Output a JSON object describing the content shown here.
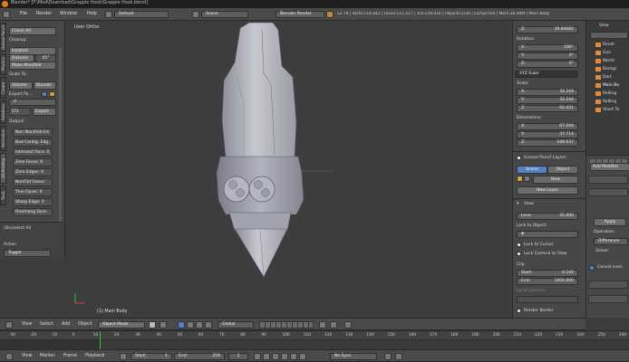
{
  "titlebar": {
    "title": "Blender* [F:\\Mod\\Download\\Grapple Hook\\Grapple Hook.blend]"
  },
  "topbar": {
    "menus": [
      "File",
      "Render",
      "Window",
      "Help"
    ],
    "layout": "Default",
    "scene": "Scene",
    "engine": "Blender Render",
    "stats": "v2.79 | Verts:114,842 | Faces:115,427 | Tris:229,016 | Objects:1/30 | Lamps:0/0 | Mem:26.90M | Main Body"
  },
  "toolshelf": {
    "check_all": "Check All",
    "cleanup_label": "Cleanup:",
    "isolated": "Isolated",
    "distorted": "Distorte",
    "distorted_angle": "45°",
    "make_manifold": "Make Manifold",
    "scale_to_label": "Scale To:",
    "volume": "Volume",
    "bounds": "Bounds",
    "export_path": "Export Pa...",
    "export_dir": "//",
    "format": "STL",
    "export": "Export",
    "output_label": "Output:",
    "output_items": [
      "Non Manifold Ed",
      "Bad Contig. Edg..",
      "Intersect Face: 0",
      "Zero Faces: 0",
      "Zero Edges: 0",
      "NonFlat Faces:",
      "Thin Faces: 0",
      "Sharp Edge: 0",
      "Overhang Face:"
    ],
    "tabs": [
      "Grease Pencil",
      "Physics",
      "Create",
      "Relations",
      "Animation",
      "3D Printing",
      "Tools"
    ],
    "operator_title": "(De)select All",
    "action_label": "Action",
    "action_value": "Toggle"
  },
  "viewport": {
    "view_label": "User Ortho",
    "object_label": "(1) Main Body"
  },
  "properties_panel": {
    "location_z": "39.84682",
    "rotation_label": "Rotation:",
    "rotation": [
      {
        "axis": "X:",
        "value": "180°"
      },
      {
        "axis": "Y:",
        "value": "0°"
      },
      {
        "axis": "Z:",
        "value": "0°"
      }
    ],
    "rotation_mode": "XYZ Euler",
    "scale_label": "Scale:",
    "scale": [
      {
        "axis": "X:",
        "value": "32.244"
      },
      {
        "axis": "Y:",
        "value": "32.244"
      },
      {
        "axis": "Z:",
        "value": "92.421"
      }
    ],
    "dimensions_label": "Dimensions:",
    "dimensions": [
      {
        "axis": "X:",
        "value": "67.204"
      },
      {
        "axis": "Y:",
        "value": "37.714"
      },
      {
        "axis": "Z:",
        "value": "198.037"
      }
    ],
    "grease_pencil": "Grease Pencil Layers",
    "scene_btn": "Scene",
    "object_btn": "Object",
    "new_btn": "New",
    "new_layer_btn": "New Layer",
    "view_section": "View",
    "lens_label": "Lens:",
    "lens_value": "35.000",
    "lock_object": "Lock to Object:",
    "lock_cursor": "Lock to Cursor",
    "lock_camera": "Lock Camera to View",
    "clip_label": "Clip:",
    "clip_start_label": "Start:",
    "clip_start": "0.100",
    "clip_end_label": "End:",
    "clip_end": "1000.000",
    "local_camera": "Local Camera",
    "render_border": "Render Border"
  },
  "outliner": {
    "view_label": "View",
    "items": [
      "Rendr",
      "Gun",
      "World",
      "Backgr",
      "Dart",
      "Main Bo",
      "Rolling",
      "Rolling",
      "Short Te"
    ]
  },
  "modifier_panel": {
    "add_modifier": "Add Modifier",
    "apply": "Apply",
    "operation_label": "Operation:",
    "operation_value": "Difference",
    "solver_label": "Solver:",
    "cancel_label": "Cancel even"
  },
  "viewport_header": {
    "menus": [
      "View",
      "Select",
      "Add",
      "Object"
    ],
    "mode": "Object Mode",
    "orientation": "Global"
  },
  "timeline": {
    "ticks": [
      "-30",
      "-20",
      "-10",
      "0",
      "10",
      "20",
      "30",
      "40",
      "50",
      "60",
      "70",
      "80",
      "90",
      "100",
      "110",
      "120",
      "130",
      "140",
      "150",
      "160",
      "170",
      "180",
      "190",
      "200",
      "210",
      "220",
      "230",
      "240",
      "250",
      "260"
    ],
    "menus": [
      "View",
      "Marker",
      "Frame",
      "Playback"
    ],
    "start_label": "Start:",
    "start": "1",
    "end_label": "End:",
    "end": "250",
    "current": "1",
    "sync": "No Sync"
  },
  "colors": {
    "accent": "#5680c2",
    "viewport_bg": "#3d3d3d",
    "panel_bg": "#4a4a4a",
    "mesh": "#a9aab4",
    "playhead": "#3fbf3f"
  }
}
